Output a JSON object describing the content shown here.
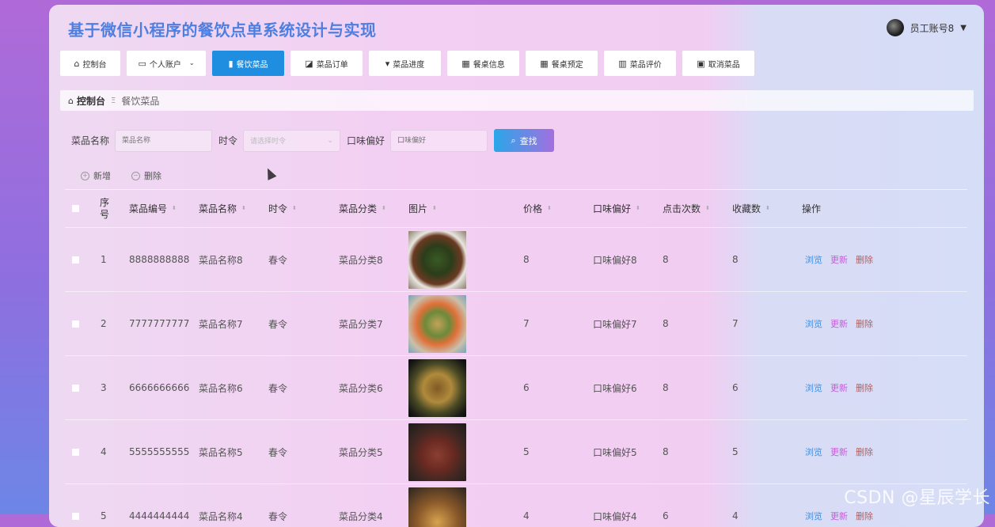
{
  "app": {
    "title": "基于微信小程序的餐饮点单系统设计与实现",
    "user": "员工账号8"
  },
  "nav": [
    {
      "label": "控制台",
      "icon": "home-icon",
      "active": false
    },
    {
      "label": "个人账户",
      "icon": "wallet-icon",
      "active": false,
      "dropdown": true
    },
    {
      "label": "餐饮菜品",
      "icon": "book-icon",
      "active": true
    },
    {
      "label": "菜品订单",
      "icon": "chart-icon",
      "active": false
    },
    {
      "label": "菜品进度",
      "icon": "cup-icon",
      "active": false
    },
    {
      "label": "餐桌信息",
      "icon": "grid-icon",
      "active": false
    },
    {
      "label": "餐桌预定",
      "icon": "grid-icon",
      "active": false
    },
    {
      "label": "菜品评价",
      "icon": "bar-chart-icon",
      "active": false
    },
    {
      "label": "取消菜品",
      "icon": "clipboard-check-icon",
      "active": false
    }
  ],
  "breadcrumb": {
    "home": "控制台",
    "current": "餐饮菜品"
  },
  "search": {
    "name_label": "菜品名称",
    "name_placeholder": "菜品名称",
    "season_label": "时令",
    "season_placeholder": "请选择时令",
    "taste_label": "口味偏好",
    "taste_placeholder": "口味偏好",
    "find_label": "查找"
  },
  "actions": {
    "add": "新增",
    "delete": "删除"
  },
  "table": {
    "headers": {
      "seq": "序号",
      "code": "菜品编号",
      "name": "菜品名称",
      "season": "时令",
      "category": "菜品分类",
      "image": "图片",
      "price": "价格",
      "taste": "口味偏好",
      "clicks": "点击次数",
      "favorites": "收藏数",
      "ops": "操作"
    },
    "ops": {
      "view": "浏览",
      "update": "更新",
      "delete": "删除"
    },
    "rows": [
      {
        "seq": "1",
        "code": "8888888888",
        "name": "菜品名称8",
        "season": "春令",
        "category": "菜品分类8",
        "price": "8",
        "taste": "口味偏好8",
        "clicks": "8",
        "favorites": "8"
      },
      {
        "seq": "2",
        "code": "7777777777",
        "name": "菜品名称7",
        "season": "春令",
        "category": "菜品分类7",
        "price": "7",
        "taste": "口味偏好7",
        "clicks": "8",
        "favorites": "7"
      },
      {
        "seq": "3",
        "code": "6666666666",
        "name": "菜品名称6",
        "season": "春令",
        "category": "菜品分类6",
        "price": "6",
        "taste": "口味偏好6",
        "clicks": "8",
        "favorites": "6"
      },
      {
        "seq": "4",
        "code": "5555555555",
        "name": "菜品名称5",
        "season": "春令",
        "category": "菜品分类5",
        "price": "5",
        "taste": "口味偏好5",
        "clicks": "8",
        "favorites": "5"
      },
      {
        "seq": "5",
        "code": "4444444444",
        "name": "菜品名称4",
        "season": "春令",
        "category": "菜品分类4",
        "price": "4",
        "taste": "口味偏好4",
        "clicks": "6",
        "favorites": "4"
      }
    ]
  },
  "watermark": "CSDN @星辰学长"
}
